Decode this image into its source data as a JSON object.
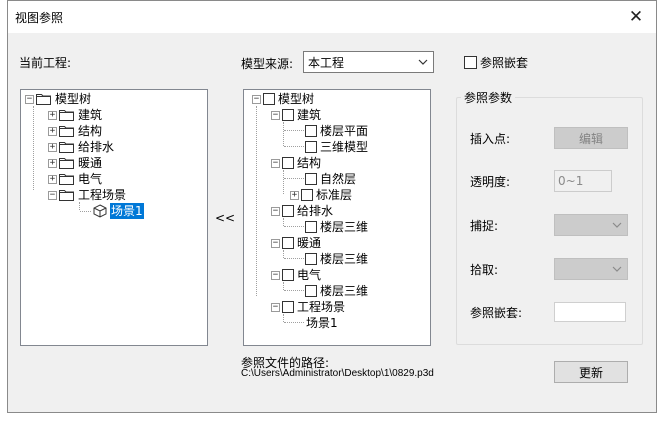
{
  "window": {
    "title": "视图参照",
    "close_glyph": "✕"
  },
  "left": {
    "label": "当前工程:",
    "tree": {
      "root": "模型树",
      "items": [
        "建筑",
        "结构",
        "给排水",
        "暖通",
        "电气",
        "工程场景"
      ],
      "scene": "场景1"
    }
  },
  "arrow_button": "<<",
  "source": {
    "label": "模型来源:",
    "selected": "本工程"
  },
  "embed_checkbox": {
    "label": "参照嵌套",
    "checked": false
  },
  "middle": {
    "tree": {
      "root": "模型树",
      "groups": [
        {
          "label": "建筑",
          "children": [
            "楼层平面",
            "三维模型"
          ]
        },
        {
          "label": "结构",
          "children": [
            "自然层",
            "标准层"
          ]
        },
        {
          "label": "给排水",
          "children": [
            "楼层三维"
          ]
        },
        {
          "label": "暖通",
          "children": [
            "楼层三维"
          ]
        },
        {
          "label": "电气",
          "children": [
            "楼层三维"
          ]
        },
        {
          "label": "工程场景",
          "children": [
            "场景1"
          ]
        }
      ]
    }
  },
  "params": {
    "legend": "参照参数",
    "insert_point": {
      "label": "插入点:",
      "button": "编辑"
    },
    "transparency": {
      "label": "透明度:",
      "value": "0~1"
    },
    "snap": {
      "label": "捕捉:"
    },
    "pick": {
      "label": "拾取:"
    },
    "nest": {
      "label": "参照嵌套:"
    }
  },
  "path": {
    "label": "参照文件的路径:",
    "value": "C:\\Users\\Administrator\\Desktop\\1\\0829.p3d"
  },
  "update_button": "更新"
}
